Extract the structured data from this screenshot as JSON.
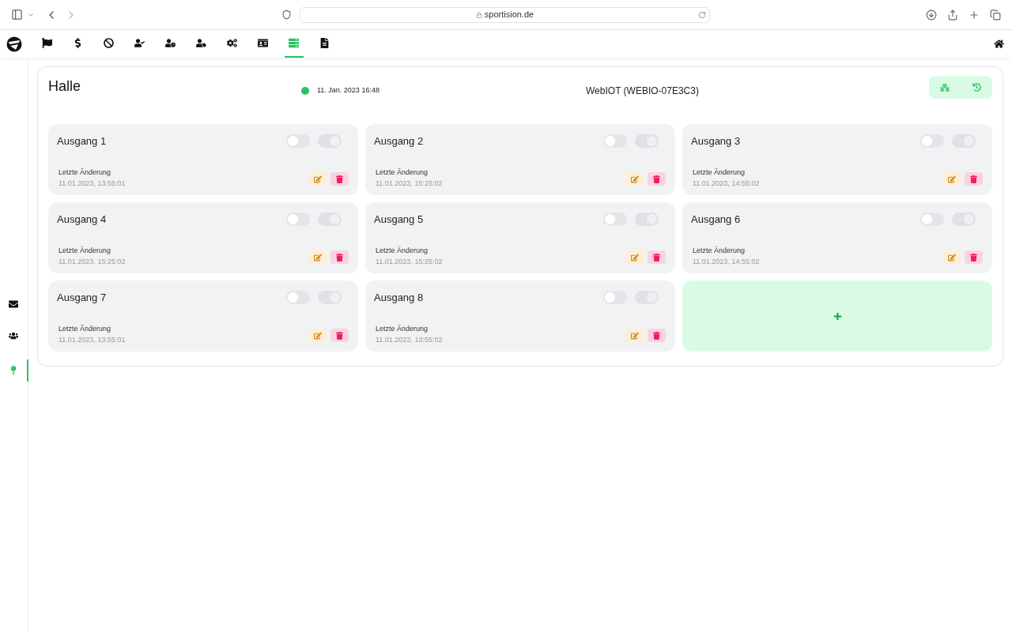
{
  "browser": {
    "url": "sportision.de"
  },
  "nav": {
    "items": [
      {
        "selected": false
      },
      {
        "selected": false
      },
      {
        "selected": false
      },
      {
        "selected": false
      },
      {
        "selected": false
      },
      {
        "selected": false
      },
      {
        "selected": false
      },
      {
        "selected": false
      },
      {
        "selected": true
      },
      {
        "selected": false
      }
    ]
  },
  "sidebar": {
    "items": [
      {
        "selected": false
      },
      {
        "selected": false
      },
      {
        "selected": true
      }
    ]
  },
  "panel": {
    "title": "Halle",
    "online": true,
    "timestamp": "11. Jan. 2023 16:48",
    "device": "WebIOT (WEBIO-07E3C3)",
    "outputs": [
      {
        "name": "Ausgang 1",
        "toggles": [
          {
            "on": false,
            "disabled": false
          },
          {
            "on": true,
            "disabled": true
          }
        ],
        "changed_label": "Letzte Änderung",
        "changed": "11.01.2023, 13:55:01"
      },
      {
        "name": "Ausgang 2",
        "toggles": [
          {
            "on": false,
            "disabled": false
          },
          {
            "on": true,
            "disabled": true
          }
        ],
        "changed_label": "Letzte Änderung",
        "changed": "11.01.2023, 15:25:02"
      },
      {
        "name": "Ausgang 3",
        "toggles": [
          {
            "on": false,
            "disabled": false
          },
          {
            "on": true,
            "disabled": true
          }
        ],
        "changed_label": "Letzte Änderung",
        "changed": "11.01.2023, 14:55:02"
      },
      {
        "name": "Ausgang 4",
        "toggles": [
          {
            "on": false,
            "disabled": false
          },
          {
            "on": true,
            "disabled": true
          }
        ],
        "changed_label": "Letzte Änderung",
        "changed": "11.01.2023, 15:25:02"
      },
      {
        "name": "Ausgang 5",
        "toggles": [
          {
            "on": false,
            "disabled": false
          },
          {
            "on": true,
            "disabled": true
          }
        ],
        "changed_label": "Letzte Änderung",
        "changed": "11.01.2023, 15:25:02"
      },
      {
        "name": "Ausgang 6",
        "toggles": [
          {
            "on": false,
            "disabled": false
          },
          {
            "on": true,
            "disabled": true
          }
        ],
        "changed_label": "Letzte Änderung",
        "changed": "11.01.2023, 14:55:02"
      },
      {
        "name": "Ausgang 7",
        "toggles": [
          {
            "on": false,
            "disabled": false
          },
          {
            "on": true,
            "disabled": true
          }
        ],
        "changed_label": "Letzte Änderung",
        "changed": "11.01.2023, 13:55:01"
      },
      {
        "name": "Ausgang 8",
        "toggles": [
          {
            "on": false,
            "disabled": false
          },
          {
            "on": true,
            "disabled": true
          }
        ],
        "changed_label": "Letzte Änderung",
        "changed": "11.01.2023, 13:55:02"
      }
    ]
  }
}
